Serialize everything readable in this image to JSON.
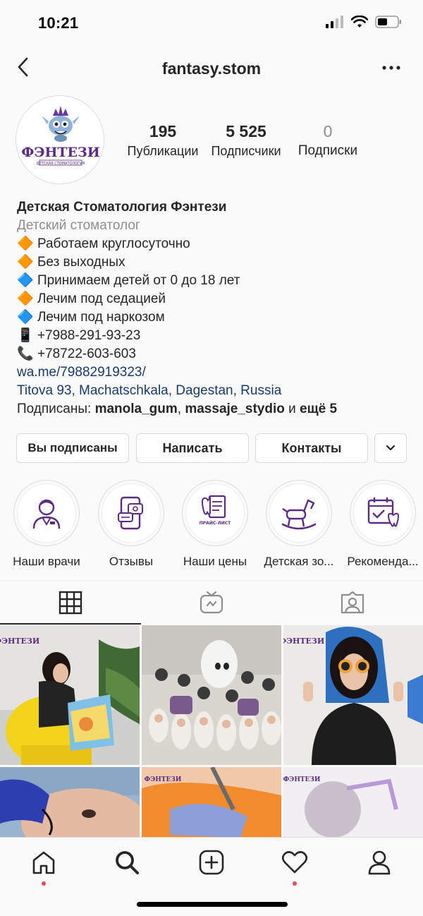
{
  "status_bar": {
    "time": "10:21"
  },
  "header": {
    "title": "fantasy.stom"
  },
  "profile": {
    "logo_text": "ФЭНТЕЗИ",
    "logo_subtext": "ДЕТСКАЯ СТОМАТОЛОГИЯ",
    "stats": [
      {
        "value": "195",
        "label": "Публикации"
      },
      {
        "value": "5 525",
        "label": "Подписчики"
      },
      {
        "value": "0",
        "label": "Подписки"
      }
    ]
  },
  "bio": {
    "name": "Детская Стоматология Фэнтези",
    "category": "Детский стоматолог",
    "lines": [
      {
        "emoji": "🔶",
        "text": "Работаем круглосуточно"
      },
      {
        "emoji": "🔶",
        "text": "Без выходных"
      },
      {
        "emoji": "🔷",
        "text": "Принимаем детей от 0 до 18 лет"
      },
      {
        "emoji": "🔶",
        "text": "Лечим под седацией"
      },
      {
        "emoji": "🔷",
        "text": "Лечим под наркозом"
      },
      {
        "emoji": "📱",
        "text": "+7988-291-93-23"
      },
      {
        "emoji": "📞",
        "text": "+78722-603-603"
      }
    ],
    "link": "wa.me/79882919323/",
    "location": "Titova 93, Machatschkala, Dagestan, Russia",
    "followed_prefix": "Подписаны: ",
    "followed_user1": "manola_gum",
    "followed_sep": ", ",
    "followed_user2": "massaje_stydio",
    "followed_and": " и ",
    "followed_more": "ещё 5"
  },
  "actions": {
    "following": "Вы подписаны",
    "message": "Написать",
    "contacts": "Контакты"
  },
  "highlights": [
    {
      "label": "Наши врачи",
      "icon": "doctor-icon"
    },
    {
      "label": "Отзывы",
      "icon": "reviews-phone-icon"
    },
    {
      "label": "Наши цены",
      "icon": "price-list-icon",
      "caption": "ПРАЙС-ЛИСТ"
    },
    {
      "label": "Детская зо...",
      "icon": "rocking-horse-icon"
    },
    {
      "label": "Рекоменда...",
      "icon": "calendar-tooth-icon"
    }
  ],
  "tabs": [
    "grid-icon",
    "igtv-icon",
    "tagged-icon"
  ],
  "colors": {
    "accent_purple": "#5b2c83",
    "link": "#1b3b6b",
    "notification": "#ed4956"
  },
  "bottom_nav": [
    "home-icon",
    "search-icon",
    "new-post-icon",
    "activity-heart-icon",
    "profile-icon"
  ]
}
